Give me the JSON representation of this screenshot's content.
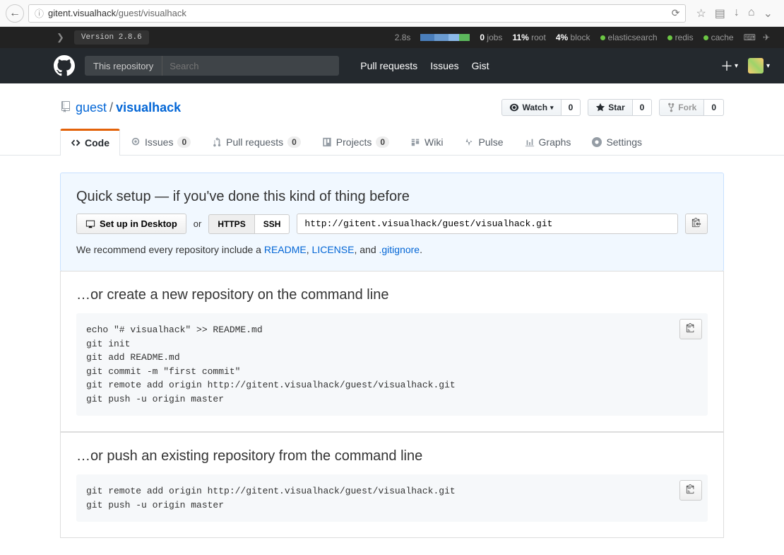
{
  "browser": {
    "url_host": "gitent.visualhack",
    "url_path": "/guest/visualhack"
  },
  "status": {
    "version": "Version 2.8.6",
    "load_time": "2.8s",
    "jobs_val": "0",
    "jobs_label": "jobs",
    "root_val": "11%",
    "root_label": "root",
    "block_val": "4%",
    "block_label": "block",
    "es": "elasticsearch",
    "redis": "redis",
    "cache": "cache"
  },
  "header": {
    "scope": "This repository",
    "search_placeholder": "Search",
    "links": {
      "pulls": "Pull requests",
      "issues": "Issues",
      "gist": "Gist"
    }
  },
  "repo": {
    "owner": "guest",
    "name": "visualhack",
    "watch_label": "Watch",
    "watch_count": "0",
    "star_label": "Star",
    "star_count": "0",
    "fork_label": "Fork",
    "fork_count": "0"
  },
  "nav": {
    "code": "Code",
    "issues": "Issues",
    "issues_count": "0",
    "pulls": "Pull requests",
    "pulls_count": "0",
    "projects": "Projects",
    "projects_count": "0",
    "wiki": "Wiki",
    "pulse": "Pulse",
    "graphs": "Graphs",
    "settings": "Settings"
  },
  "setup": {
    "title": "Quick setup — if you've done this kind of thing before",
    "desktop": "Set up in Desktop",
    "or": "or",
    "https": "HTTPS",
    "ssh": "SSH",
    "clone_url": "http://gitent.visualhack/guest/visualhack.git",
    "recommend_prefix": "We recommend every repository include a ",
    "readme": "README",
    "license": "LICENSE",
    "gitignore": ".gitignore",
    "recommend_mid1": ", ",
    "recommend_mid2": ", and ",
    "recommend_end": "."
  },
  "section1": {
    "title": "…or create a new repository on the command line",
    "code": "echo \"# visualhack\" >> README.md\ngit init\ngit add README.md\ngit commit -m \"first commit\"\ngit remote add origin http://gitent.visualhack/guest/visualhack.git\ngit push -u origin master"
  },
  "section2": {
    "title": "…or push an existing repository from the command line",
    "code": "git remote add origin http://gitent.visualhack/guest/visualhack.git\ngit push -u origin master"
  }
}
